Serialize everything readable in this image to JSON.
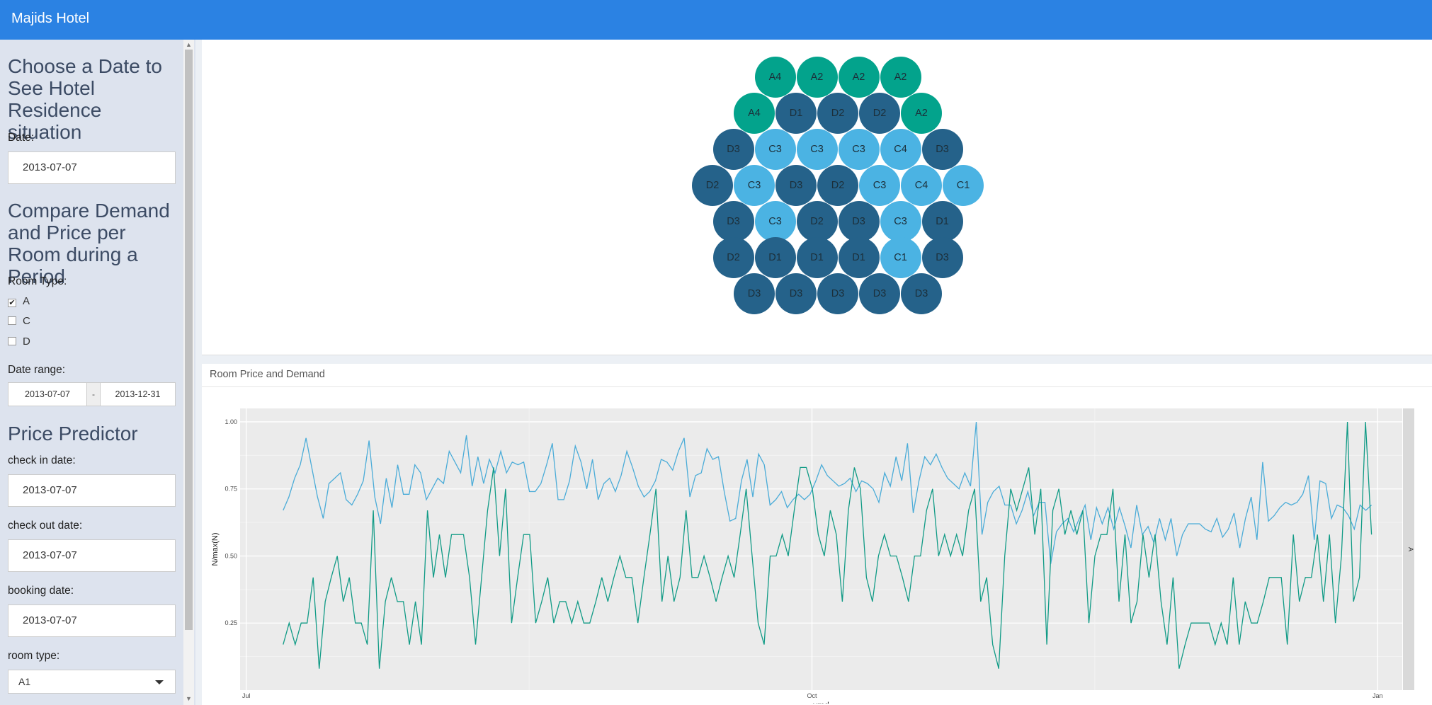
{
  "header": {
    "title": "Majids Hotel"
  },
  "sidebar": {
    "section1_title": "Choose a Date to See Hotel Residence situation",
    "date_label": "Date:",
    "date_value": "2013-07-07",
    "section2_title": "Compare Demand and Price per Room during a Period",
    "room_type_label": "Room Type:",
    "room_types": [
      {
        "label": "A",
        "checked": true
      },
      {
        "label": "C",
        "checked": false
      },
      {
        "label": "D",
        "checked": false
      }
    ],
    "date_range_label": "Date range:",
    "date_range_start": "2013-07-07",
    "date_range_sep": "-",
    "date_range_end": "2013-12-31",
    "section3_title": "Price Predictor",
    "checkin_label": "check in date:",
    "checkin_value": "2013-07-07",
    "checkout_label": "check out date:",
    "checkout_value": "2013-07-07",
    "booking_label": "booking date:",
    "booking_value": "2013-07-07",
    "roomtype_select_label": "room type:",
    "roomtype_select_value": "A1"
  },
  "room_map": {
    "rows": [
      [
        "A4",
        "A2",
        "A2",
        "A2"
      ],
      [
        "A4",
        "D1",
        "D2",
        "D2",
        "A2"
      ],
      [
        "D3",
        "C3",
        "C3",
        "C3",
        "C4",
        "D3"
      ],
      [
        "D2",
        "C3",
        "D3",
        "D2",
        "C3",
        "C4",
        "C1"
      ],
      [
        "D3",
        "C3",
        "D2",
        "D3",
        "C3",
        "D1"
      ],
      [
        "D2",
        "D1",
        "D1",
        "D1",
        "C1",
        "D3"
      ],
      [
        "D3",
        "D3",
        "D3",
        "D3",
        "D3"
      ]
    ],
    "colors": {
      "A": "#03a38c",
      "C": "#4bb3e3",
      "D": "#25628a"
    }
  },
  "chart_panel": {
    "title": "Room Price and Demand"
  },
  "chart_data": {
    "type": "line",
    "xlabel": "ymd",
    "ylabel": "N/max(N)",
    "facet_label": "A",
    "x_ticks": [
      "Jul",
      "Oct",
      "Jan"
    ],
    "y_ticks": [
      "0.25",
      "0.50",
      "0.75",
      "1.00"
    ],
    "xlim": [
      "2013-06-30",
      "2014-01-05"
    ],
    "ylim": [
      0.0,
      1.05
    ],
    "x_start": "2013-07-07",
    "x_end": "2013-12-31",
    "grid": true,
    "series": [
      {
        "color": "#4bacd8",
        "values": [
          0.67,
          0.72,
          0.79,
          0.84,
          0.94,
          0.83,
          0.72,
          0.64,
          0.77,
          0.79,
          0.81,
          0.71,
          0.69,
          0.73,
          0.78,
          0.93,
          0.72,
          0.62,
          0.79,
          0.68,
          0.84,
          0.73,
          0.73,
          0.84,
          0.81,
          0.71,
          0.75,
          0.79,
          0.77,
          0.89,
          0.85,
          0.81,
          0.95,
          0.76,
          0.87,
          0.77,
          0.86,
          0.81,
          0.89,
          0.81,
          0.85,
          0.84,
          0.85,
          0.74,
          0.74,
          0.77,
          0.84,
          0.92,
          0.71,
          0.71,
          0.78,
          0.91,
          0.85,
          0.75,
          0.86,
          0.71,
          0.77,
          0.79,
          0.74,
          0.8,
          0.89,
          0.83,
          0.76,
          0.72,
          0.74,
          0.78,
          0.86,
          0.85,
          0.82,
          0.89,
          0.94,
          0.72,
          0.8,
          0.81,
          0.9,
          0.86,
          0.87,
          0.74,
          0.63,
          0.64,
          0.78,
          0.86,
          0.72,
          0.88,
          0.84,
          0.69,
          0.71,
          0.74,
          0.68,
          0.71,
          0.73,
          0.71,
          0.73,
          0.78,
          0.84,
          0.8,
          0.78,
          0.76,
          0.77,
          0.79,
          0.74,
          0.78,
          0.77,
          0.75,
          0.7,
          0.81,
          0.76,
          0.87,
          0.78,
          0.92,
          0.66,
          0.78,
          0.87,
          0.84,
          0.88,
          0.83,
          0.79,
          0.77,
          0.75,
          0.81,
          0.76,
          1.0,
          0.58,
          0.7,
          0.74,
          0.76,
          0.69,
          0.69,
          0.62,
          0.67,
          0.74,
          0.65,
          0.7,
          0.7,
          0.47,
          0.59,
          0.62,
          0.64,
          0.59,
          0.64,
          0.69,
          0.56,
          0.68,
          0.62,
          0.68,
          0.6,
          0.68,
          0.61,
          0.53,
          0.69,
          0.58,
          0.61,
          0.55,
          0.64,
          0.56,
          0.64,
          0.5,
          0.58,
          0.62,
          0.62,
          0.62,
          0.6,
          0.59,
          0.64,
          0.57,
          0.6,
          0.66,
          0.53,
          0.64,
          0.72,
          0.56,
          0.85,
          0.63,
          0.65,
          0.68,
          0.7,
          0.69,
          0.7,
          0.73,
          0.8,
          0.56,
          0.78,
          0.77,
          0.64,
          0.69,
          0.68,
          0.65,
          0.6,
          0.69,
          0.67,
          0.69
        ]
      },
      {
        "color": "#119b86",
        "values": [
          0.17,
          0.25,
          0.17,
          0.25,
          0.25,
          0.42,
          0.08,
          0.33,
          0.42,
          0.5,
          0.33,
          0.42,
          0.25,
          0.25,
          0.17,
          0.67,
          0.08,
          0.33,
          0.42,
          0.33,
          0.33,
          0.17,
          0.33,
          0.17,
          0.67,
          0.42,
          0.58,
          0.42,
          0.58,
          0.58,
          0.58,
          0.42,
          0.17,
          0.42,
          0.67,
          0.83,
          0.5,
          0.75,
          0.25,
          0.42,
          0.58,
          0.58,
          0.25,
          0.33,
          0.42,
          0.25,
          0.33,
          0.33,
          0.25,
          0.33,
          0.25,
          0.25,
          0.33,
          0.42,
          0.33,
          0.42,
          0.5,
          0.42,
          0.42,
          0.25,
          0.42,
          0.58,
          0.75,
          0.33,
          0.5,
          0.33,
          0.42,
          0.67,
          0.42,
          0.42,
          0.5,
          0.42,
          0.33,
          0.42,
          0.5,
          0.42,
          0.58,
          0.75,
          0.5,
          0.25,
          0.17,
          0.5,
          0.5,
          0.58,
          0.5,
          0.67,
          0.83,
          0.83,
          0.75,
          0.58,
          0.5,
          0.67,
          0.58,
          0.33,
          0.67,
          0.83,
          0.75,
          0.42,
          0.33,
          0.5,
          0.58,
          0.5,
          0.5,
          0.42,
          0.33,
          0.5,
          0.5,
          0.67,
          0.75,
          0.5,
          0.58,
          0.5,
          0.58,
          0.5,
          0.67,
          0.75,
          0.33,
          0.42,
          0.17,
          0.08,
          0.5,
          0.75,
          0.67,
          0.75,
          0.83,
          0.58,
          0.75,
          0.17,
          0.67,
          0.75,
          0.58,
          0.67,
          0.58,
          0.67,
          0.25,
          0.5,
          0.58,
          0.58,
          0.75,
          0.33,
          0.58,
          0.25,
          0.33,
          0.58,
          0.42,
          0.58,
          0.33,
          0.17,
          0.42,
          0.08,
          0.17,
          0.25,
          0.25,
          0.25,
          0.25,
          0.17,
          0.25,
          0.17,
          0.42,
          0.17,
          0.33,
          0.25,
          0.25,
          0.33,
          0.42,
          0.42,
          0.42,
          0.17,
          0.58,
          0.33,
          0.42,
          0.42,
          0.58,
          0.33,
          0.58,
          0.25,
          0.5,
          1.0,
          0.33,
          0.42,
          1.0,
          0.58
        ]
      }
    ]
  }
}
